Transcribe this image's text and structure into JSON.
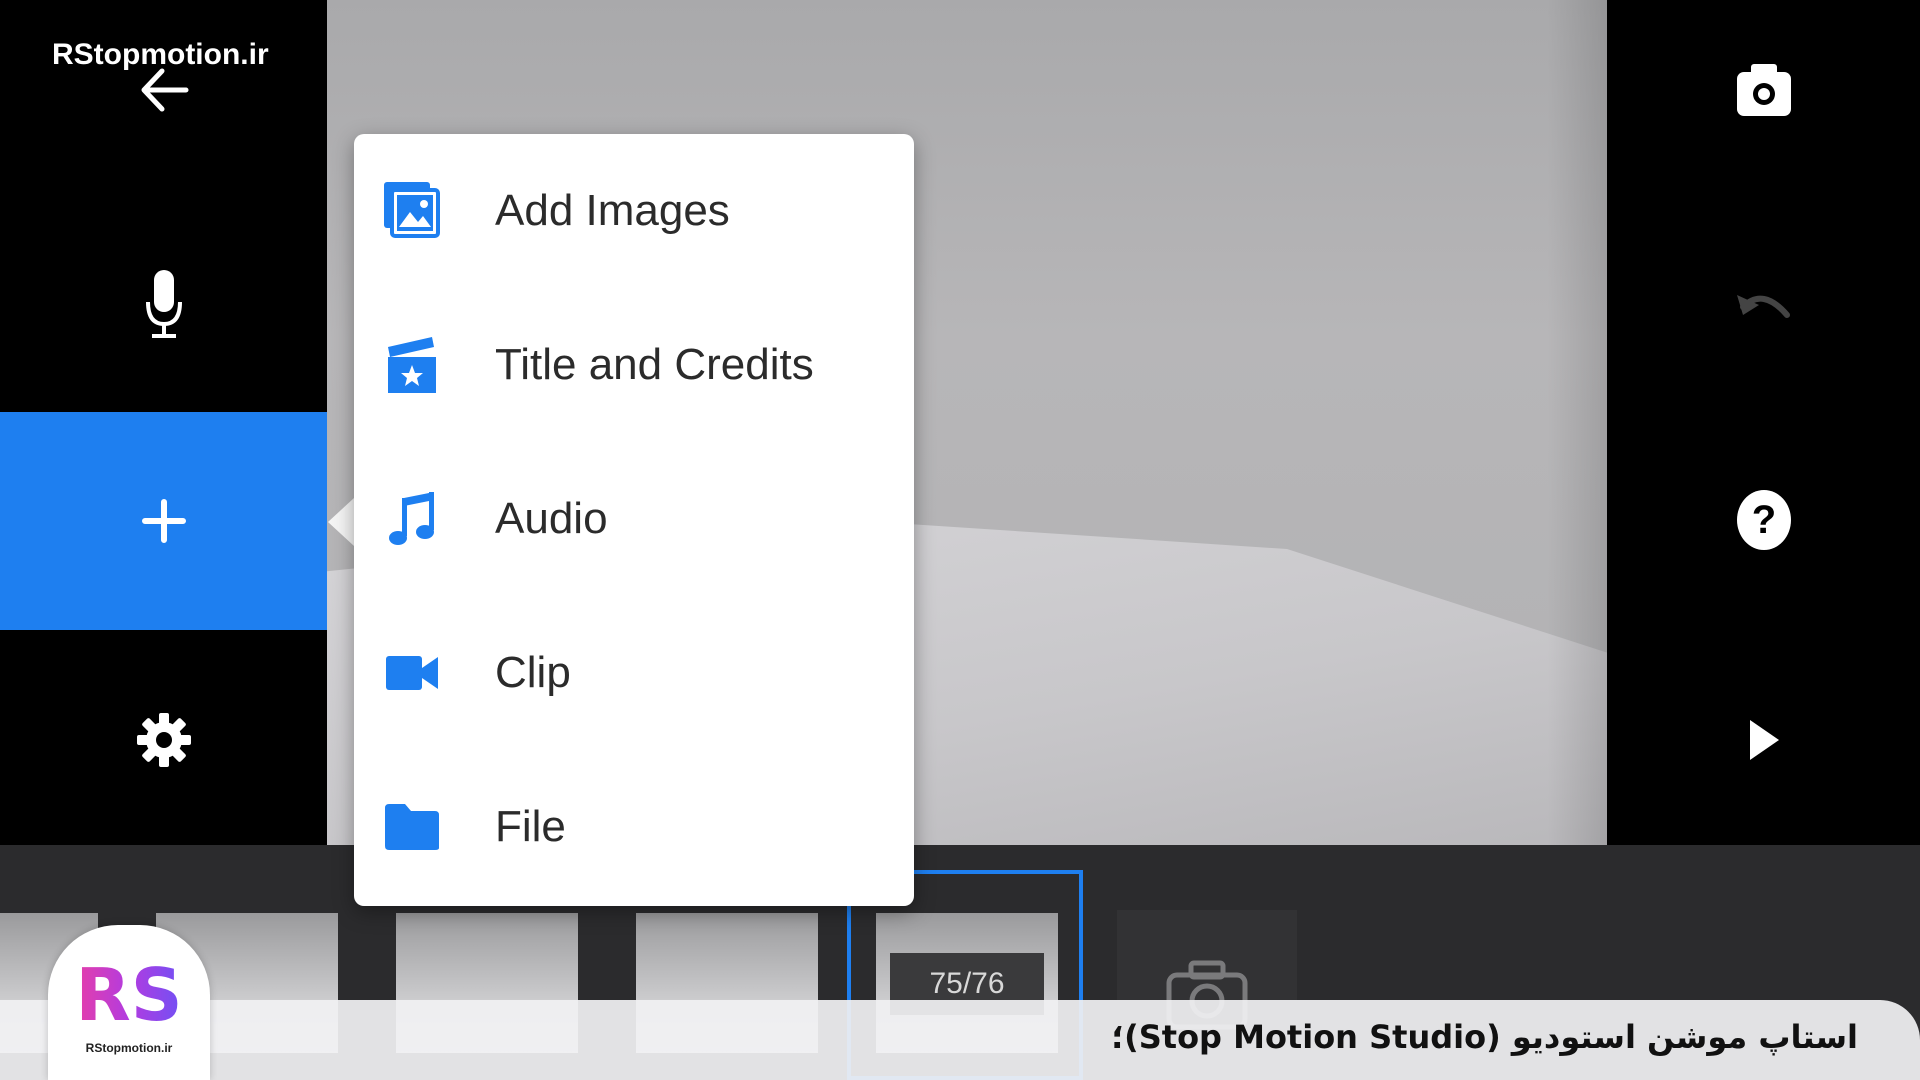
{
  "watermark": "RStopmotion.ir",
  "menu": {
    "items": [
      {
        "label": "Add Images",
        "icon": "add-images-icon"
      },
      {
        "label": "Title and Credits",
        "icon": "title-credits-icon"
      },
      {
        "label": "Audio",
        "icon": "music-note-icon"
      },
      {
        "label": "Clip",
        "icon": "video-camera-icon"
      },
      {
        "label": "File",
        "icon": "folder-icon"
      }
    ]
  },
  "left_bar": {
    "icons": [
      "back-arrow-icon",
      "microphone-icon",
      "plus-icon",
      "gear-icon"
    ]
  },
  "right_bar": {
    "icons": [
      "camera-icon",
      "undo-icon",
      "help-icon",
      "play-icon"
    ]
  },
  "filmstrip": {
    "counter": "75/76"
  },
  "caption": {
    "text": "استاپ موشن استودیو (Stop Motion Studio)؛"
  },
  "logo": {
    "mark": "RS",
    "subtitle": "RStopmotion.ir"
  },
  "colors": {
    "accent": "#1e7ff0",
    "menu_background": "#ffffff",
    "bar_background": "#000000"
  }
}
